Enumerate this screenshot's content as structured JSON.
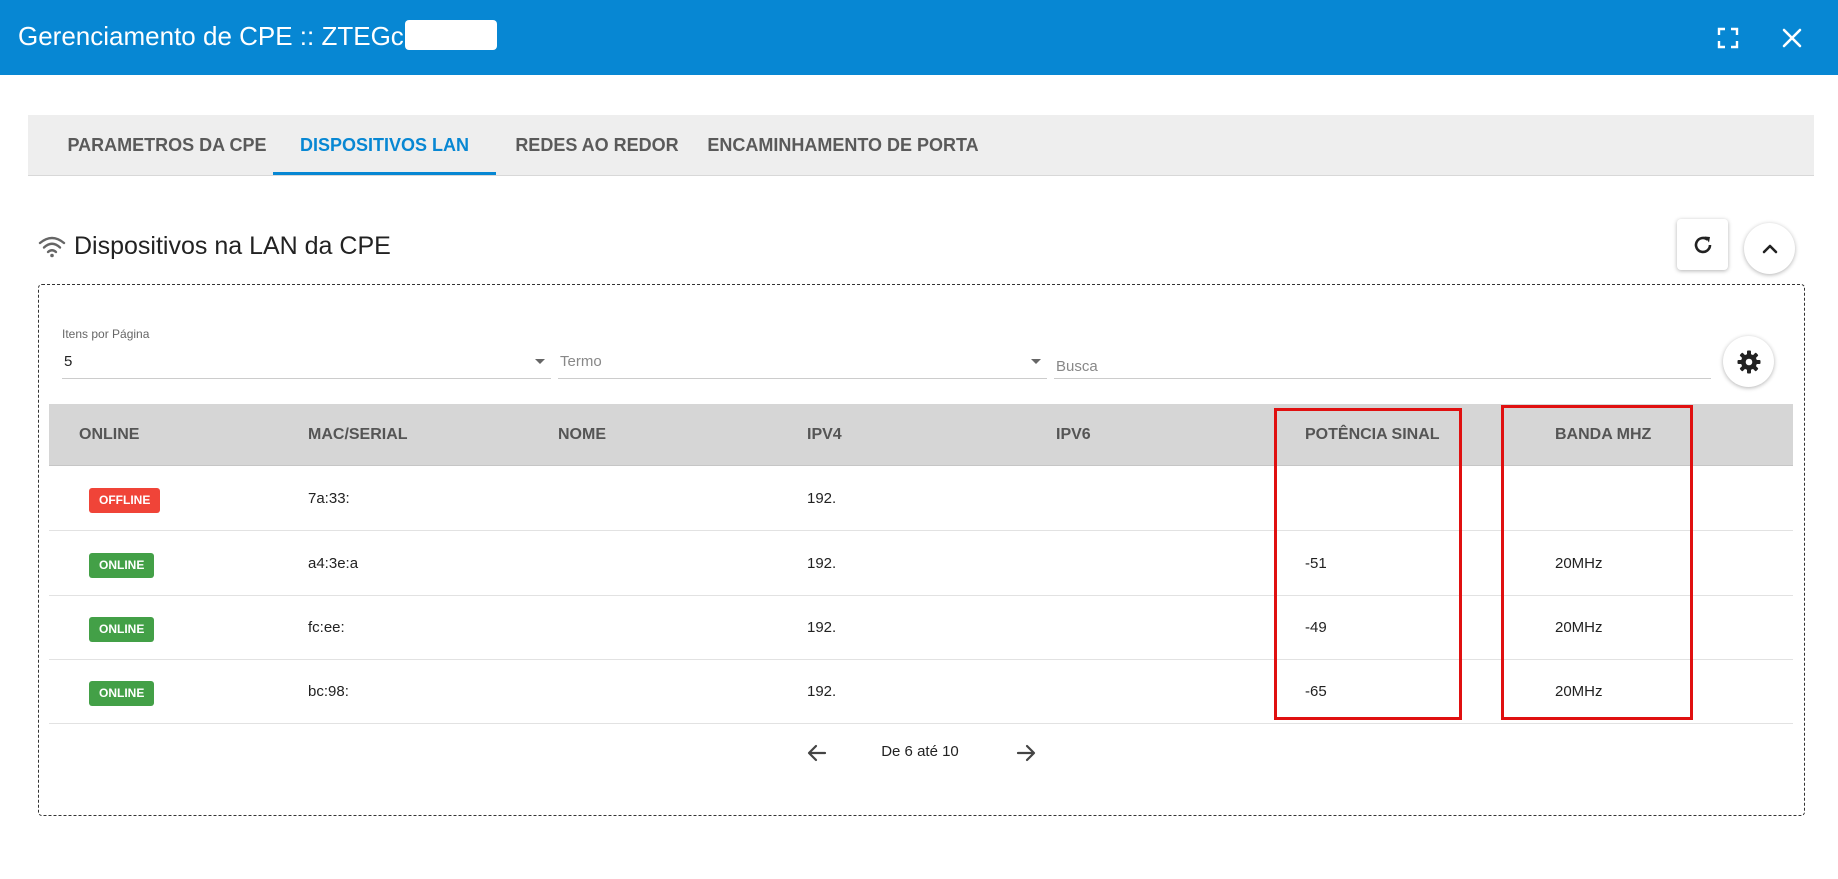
{
  "window": {
    "title": "Gerenciamento de CPE :: ZTEGc",
    "icons": {
      "fullscreen": "fullscreen-icon",
      "close": "close-icon"
    }
  },
  "tabs": [
    {
      "label": "PARAMETROS DA CPE",
      "active": false
    },
    {
      "label": "DISPOSITIVOS LAN",
      "active": true
    },
    {
      "label": "REDES AO REDOR",
      "active": false
    },
    {
      "label": "ENCAMINHAMENTO DE PORTA",
      "active": false
    }
  ],
  "section": {
    "title": "Dispositivos na LAN da CPE",
    "icon": "wifi-icon",
    "actions": {
      "refresh_icon": "refresh-icon",
      "collapse_icon": "chevron-up-icon"
    }
  },
  "filters": {
    "items_per_page_label": "Itens por Página",
    "items_per_page_value": "5",
    "term_placeholder": "Termo",
    "search_placeholder": "Busca",
    "settings_icon": "gear-icon"
  },
  "table": {
    "columns": [
      "ONLINE",
      "MAC/SERIAL",
      "NOME",
      "IPV4",
      "IPV6",
      "POTÊNCIA SINAL",
      "BANDA MHZ"
    ],
    "rows": [
      {
        "status": "OFFLINE",
        "mac": "7a:33:",
        "nome": "",
        "ipv4": "192.",
        "ipv6": "",
        "potencia": "",
        "banda": ""
      },
      {
        "status": "ONLINE",
        "mac": "a4:3e:a",
        "nome": "",
        "ipv4": "192.",
        "ipv6": "",
        "potencia": "-51",
        "banda": "20MHz"
      },
      {
        "status": "ONLINE",
        "mac": "fc:ee:",
        "nome": "",
        "ipv4": "192.",
        "ipv6": "",
        "potencia": "-49",
        "banda": "20MHz"
      },
      {
        "status": "ONLINE",
        "mac": "bc:98:",
        "nome": "",
        "ipv4": "192.",
        "ipv6": "",
        "potencia": "-65",
        "banda": "20MHz"
      }
    ]
  },
  "pagination": {
    "text": "De 6 até 10",
    "prev_icon": "arrow-left-icon",
    "next_icon": "arrow-right-icon"
  },
  "colors": {
    "accent": "#0787d3",
    "offline": "#f04438",
    "online": "#43a047",
    "highlight": "#e01010"
  }
}
